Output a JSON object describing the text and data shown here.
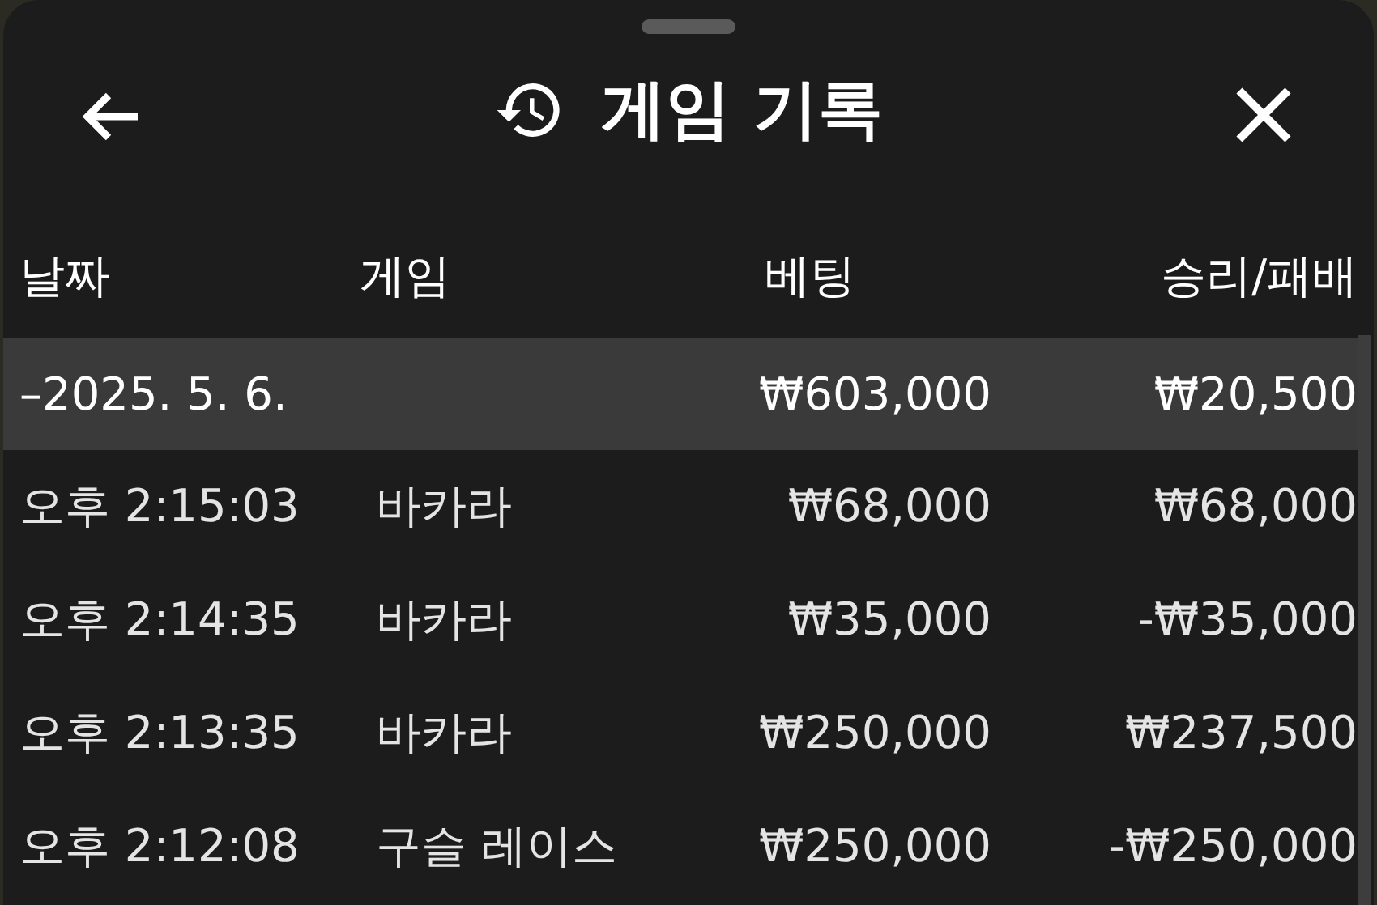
{
  "header": {
    "title": "게임 기록"
  },
  "table": {
    "columns": [
      "날짜",
      "게임",
      "베팅",
      "승리/패배"
    ],
    "rows": [
      {
        "kind": "summary",
        "date": "–2025. 5. 6.",
        "game": "",
        "bet": "₩603,000",
        "result": "₩20,500"
      },
      {
        "kind": "entry",
        "date": "오후 2:15:03",
        "game": "바카라",
        "bet": "₩68,000",
        "result": "₩68,000"
      },
      {
        "kind": "entry",
        "date": "오후 2:14:35",
        "game": "바카라",
        "bet": "₩35,000",
        "result": "-₩35,000"
      },
      {
        "kind": "entry",
        "date": "오후 2:13:35",
        "game": "바카라",
        "bet": "₩250,000",
        "result": "₩237,500"
      },
      {
        "kind": "entry",
        "date": "오후 2:12:08",
        "game": "구슬 레이스",
        "bet": "₩250,000",
        "result": "-₩250,000"
      }
    ]
  }
}
